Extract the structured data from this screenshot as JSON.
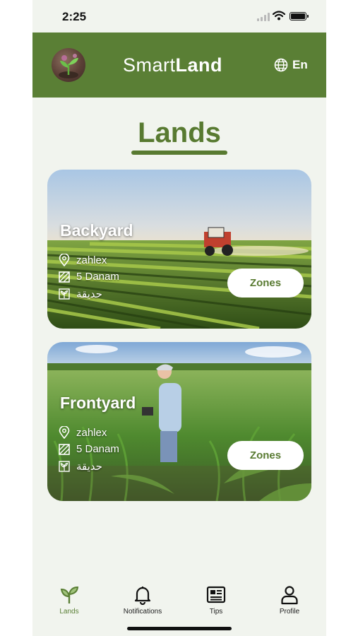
{
  "status_bar": {
    "time": "2:25"
  },
  "header": {
    "brand_part1": "Smart",
    "brand_part2": "Land",
    "language": "En",
    "language_icon": "globe-icon",
    "logo_icon": "sprout-logo"
  },
  "page": {
    "title": "Lands"
  },
  "lands": [
    {
      "name": "Backyard",
      "location": "zahlex",
      "area": "5 Danam",
      "type": "حديقة",
      "zones_label": "Zones"
    },
    {
      "name": "Frontyard",
      "location": "zahlex",
      "area": "5 Danam",
      "type": "حديقة",
      "zones_label": "Zones"
    }
  ],
  "tab_bar": {
    "tabs": [
      {
        "label": "Lands",
        "icon": "sprout-icon",
        "active": true
      },
      {
        "label": "Notifications",
        "icon": "bell-icon",
        "active": false
      },
      {
        "label": "Tips",
        "icon": "newspaper-icon",
        "active": false
      },
      {
        "label": "Profile",
        "icon": "person-icon",
        "active": false
      }
    ]
  },
  "colors": {
    "brand_green": "#5a7f35",
    "background": "#f1f4ee",
    "button_bg": "#ffffff"
  }
}
